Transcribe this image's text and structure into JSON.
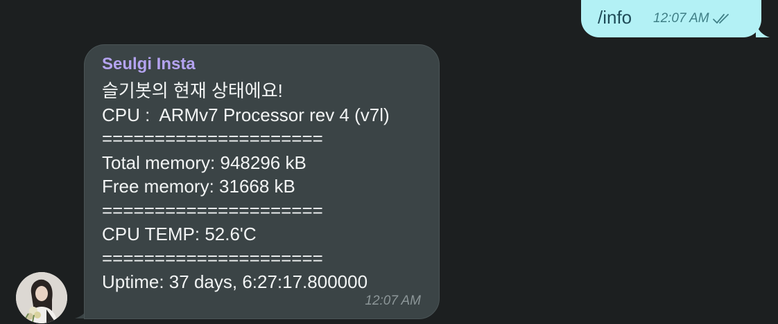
{
  "outgoing_message": {
    "text": "/info",
    "time": "12:07 AM",
    "status_icon": "double-check-icon",
    "bubble_color": "#b3f1f5"
  },
  "incoming_message": {
    "sender": "Seulgi Insta",
    "sender_color": "#b4a3f0",
    "lines": [
      "슬기봇의 현재 상태에요!",
      "CPU :  ARMv7 Processor rev 4 (v7l)",
      "=====================",
      "Total memory: 948296 kB",
      "Free memory: 31668 kB",
      "=====================",
      "CPU TEMP: 52.6'C",
      "=====================",
      "Uptime: 37 days, 6:27:17.800000"
    ],
    "time": "12:07 AM",
    "bubble_color": "#3b4446"
  },
  "avatar": {
    "icon": "profile-photo"
  }
}
